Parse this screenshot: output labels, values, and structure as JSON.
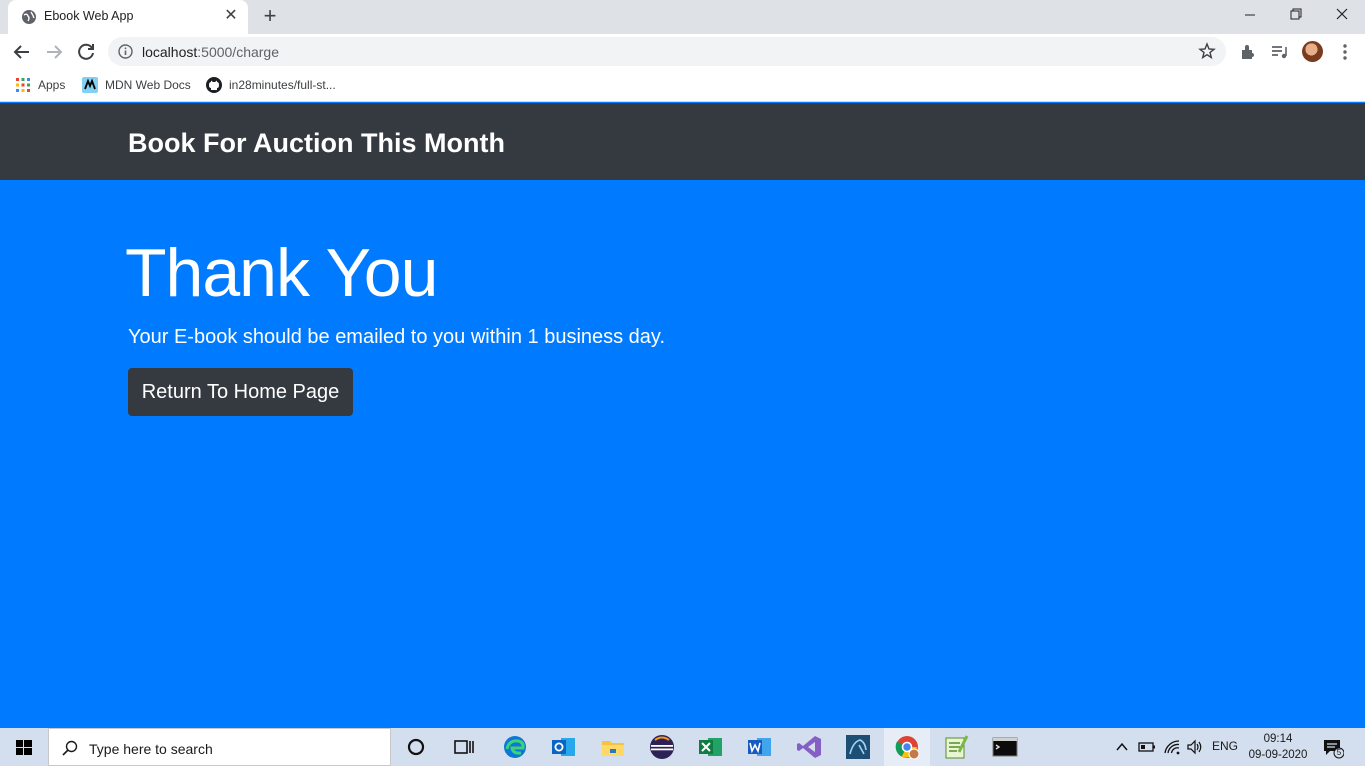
{
  "browser": {
    "tab": {
      "title": "Ebook Web App",
      "close_glyph": "✕"
    },
    "new_tab_glyph": "+",
    "window_controls": {
      "minimize": "—",
      "maximize": "❐",
      "close": "✕"
    },
    "address": {
      "host": "localhost",
      "path": ":5000/charge"
    },
    "bookmarks": [
      {
        "label": "Apps",
        "icon": "apps-grid-icon"
      },
      {
        "label": "MDN Web Docs",
        "icon": "mdn-icon"
      },
      {
        "label": "in28minutes/full-st...",
        "icon": "github-icon"
      }
    ]
  },
  "page": {
    "brand": "Book For Auction This Month",
    "heading": "Thank You",
    "lead": "Your E-book should be emailed to you within 1 business day.",
    "button_label": "Return To Home Page",
    "colors": {
      "navbar": "#343a40",
      "jumbotron": "#007bff",
      "button": "#343a40"
    }
  },
  "taskbar": {
    "search_placeholder": "Type here to search",
    "apps": [
      "cortana-icon",
      "task-view-icon",
      "edge-icon",
      "outlook-icon",
      "file-explorer-icon",
      "eclipse-icon",
      "excel-icon",
      "word-icon",
      "visual-studio-icon",
      "mysql-workbench-icon",
      "chrome-icon",
      "notepad-plus-icon",
      "terminal-icon"
    ],
    "language": "ENG",
    "time": "09:14",
    "date": "09-09-2020",
    "notifications_count": "5"
  }
}
